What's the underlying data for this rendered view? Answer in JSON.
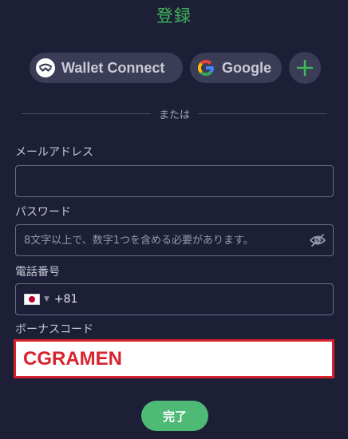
{
  "title": "登録",
  "social": {
    "walletconnect_label": "Wallet Connect",
    "google_label": "Google",
    "more_icon": "plus-icon"
  },
  "divider_text": "または",
  "email": {
    "label": "メールアドレス",
    "value": "",
    "placeholder": ""
  },
  "password": {
    "label": "パスワード",
    "placeholder": "8文字以上で、数字1つを含める必要があります。",
    "toggle_icon": "eye-slash-icon"
  },
  "phone": {
    "label": "電話番号",
    "country": "JP",
    "dial_code": "+81",
    "value": ""
  },
  "bonus": {
    "label": "ボーナスコード",
    "value": "CGRAMEN"
  },
  "submit_label": "完了",
  "colors": {
    "accent": "#3fb659",
    "highlight": "#d8222e",
    "button": "#4fb976",
    "background": "#1d1f37"
  }
}
